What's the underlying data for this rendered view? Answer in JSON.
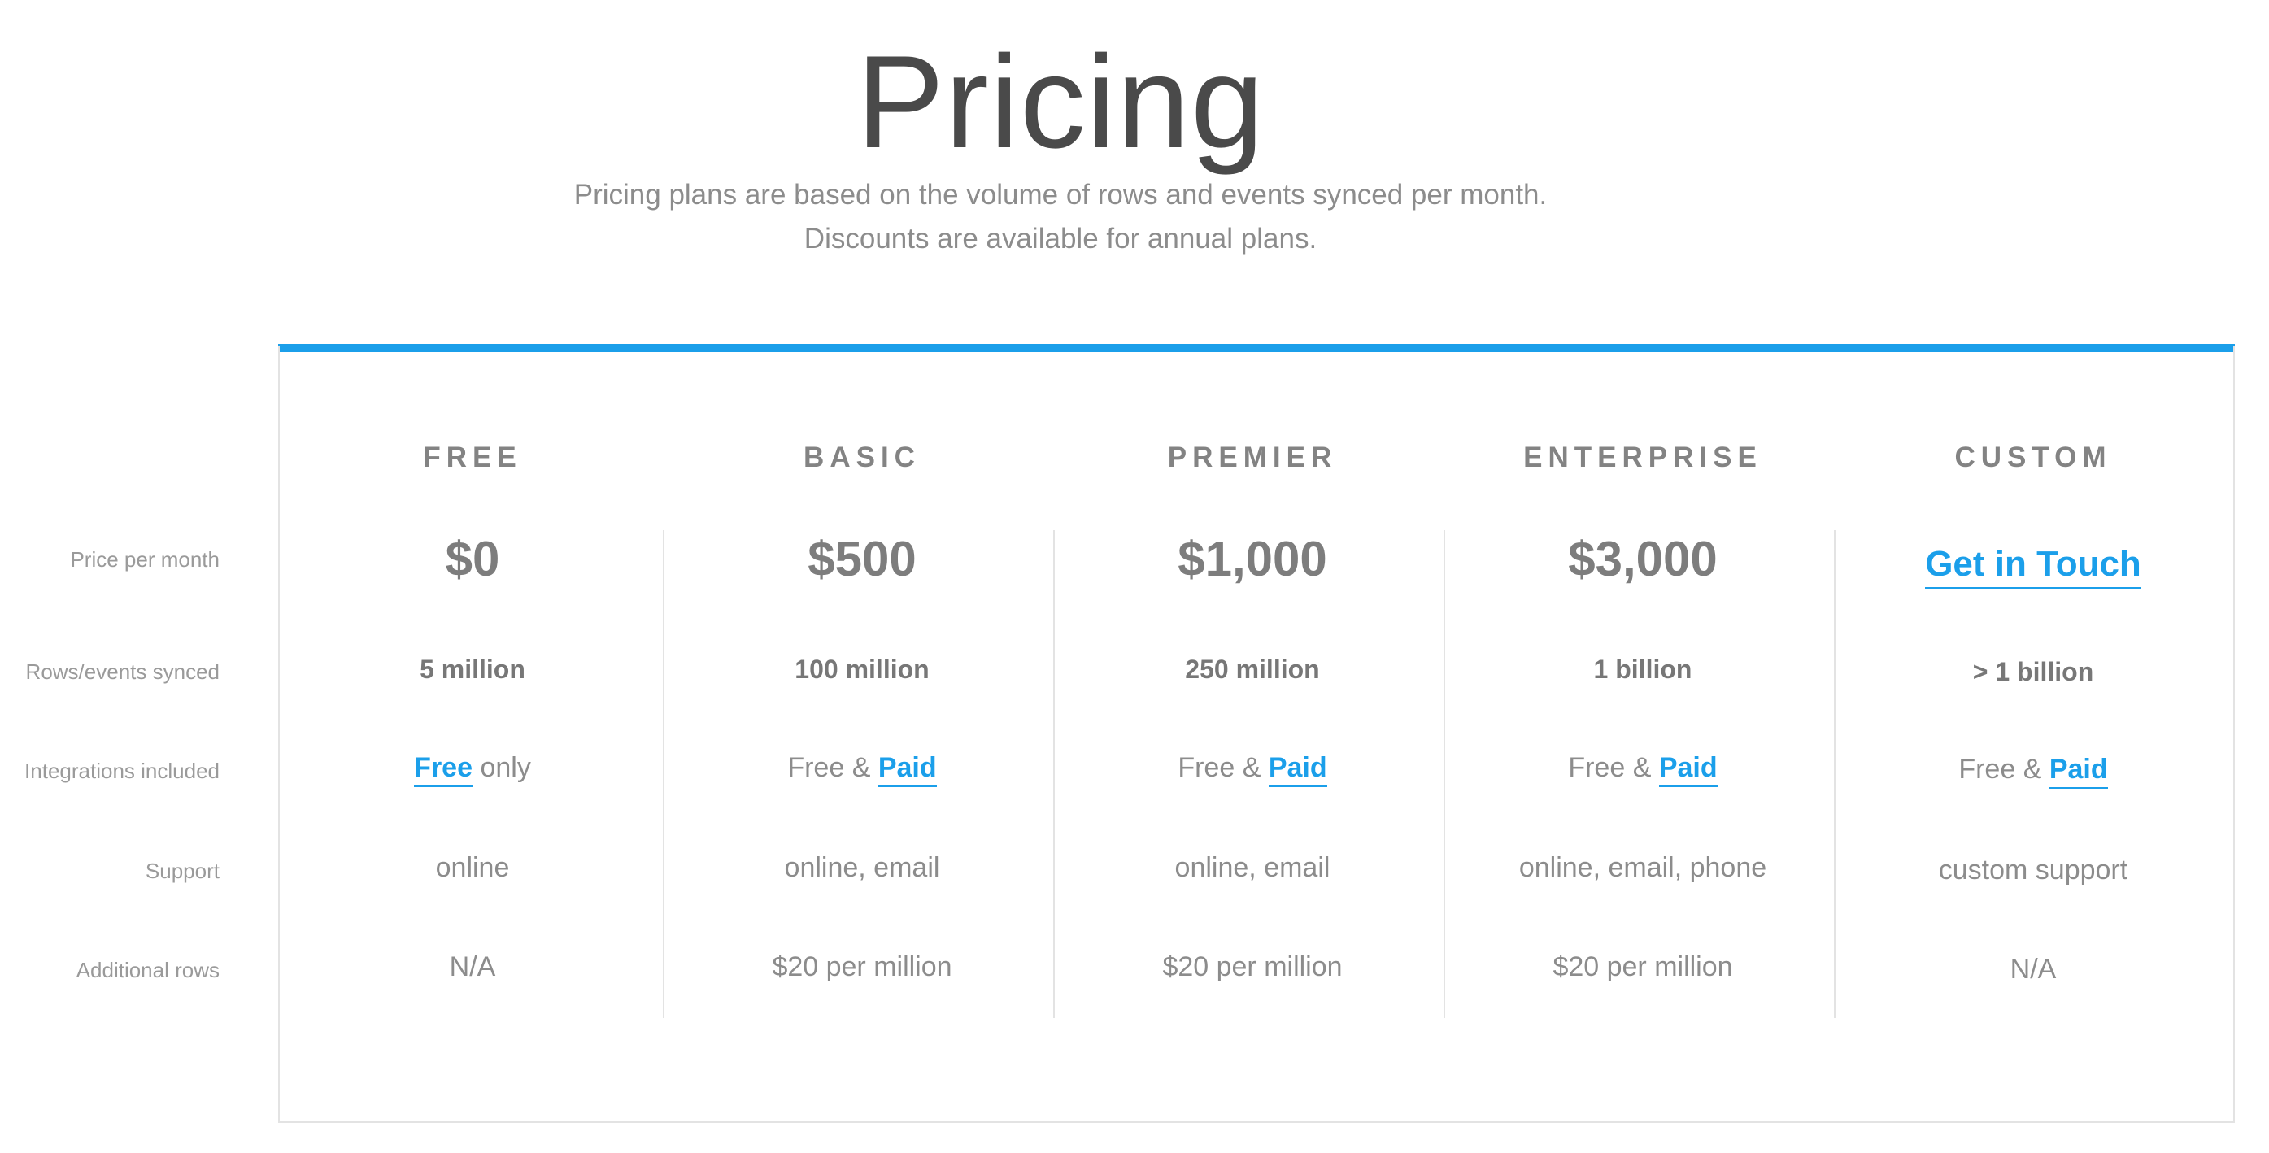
{
  "header": {
    "title": "Pricing",
    "subtitle_line1": "Pricing plans are based on the volume of rows and events synced per month.",
    "subtitle_line2": "Discounts are available for annual plans."
  },
  "row_labels": {
    "price": "Price per month",
    "rows": "Rows/events synced",
    "integrations": "Integrations included",
    "support": "Support",
    "additional": "Additional rows"
  },
  "plans": [
    {
      "name": "FREE",
      "price": "$0",
      "rows": "5 million",
      "integrations_link": "Free",
      "integrations_suffix": " only",
      "support": "online",
      "additional": "N/A"
    },
    {
      "name": "BASIC",
      "price": "$500",
      "rows": "100 million",
      "integrations_prefix": "Free & ",
      "integrations_link": "Paid",
      "support": "online, email",
      "additional": "$20 per million"
    },
    {
      "name": "PREMIER",
      "price": "$1,000",
      "rows": "250 million",
      "integrations_prefix": "Free & ",
      "integrations_link": "Paid",
      "support": "online, email",
      "additional": "$20 per million"
    },
    {
      "name": "ENTERPRISE",
      "price": "$3,000",
      "rows": "1 billion",
      "integrations_prefix": "Free & ",
      "integrations_link": "Paid",
      "support": "online, email, phone",
      "additional": "$20 per million"
    },
    {
      "name": "CUSTOM",
      "price_link": "Get in Touch",
      "rows": "> 1 billion",
      "integrations_prefix": "Free & ",
      "integrations_link": "Paid",
      "support": "custom support",
      "additional": "N/A"
    }
  ],
  "colors": {
    "accent": "#1b9fea",
    "title": "#4a4a4a",
    "text": "#8c8c8c",
    "border": "#e3e3e3"
  }
}
